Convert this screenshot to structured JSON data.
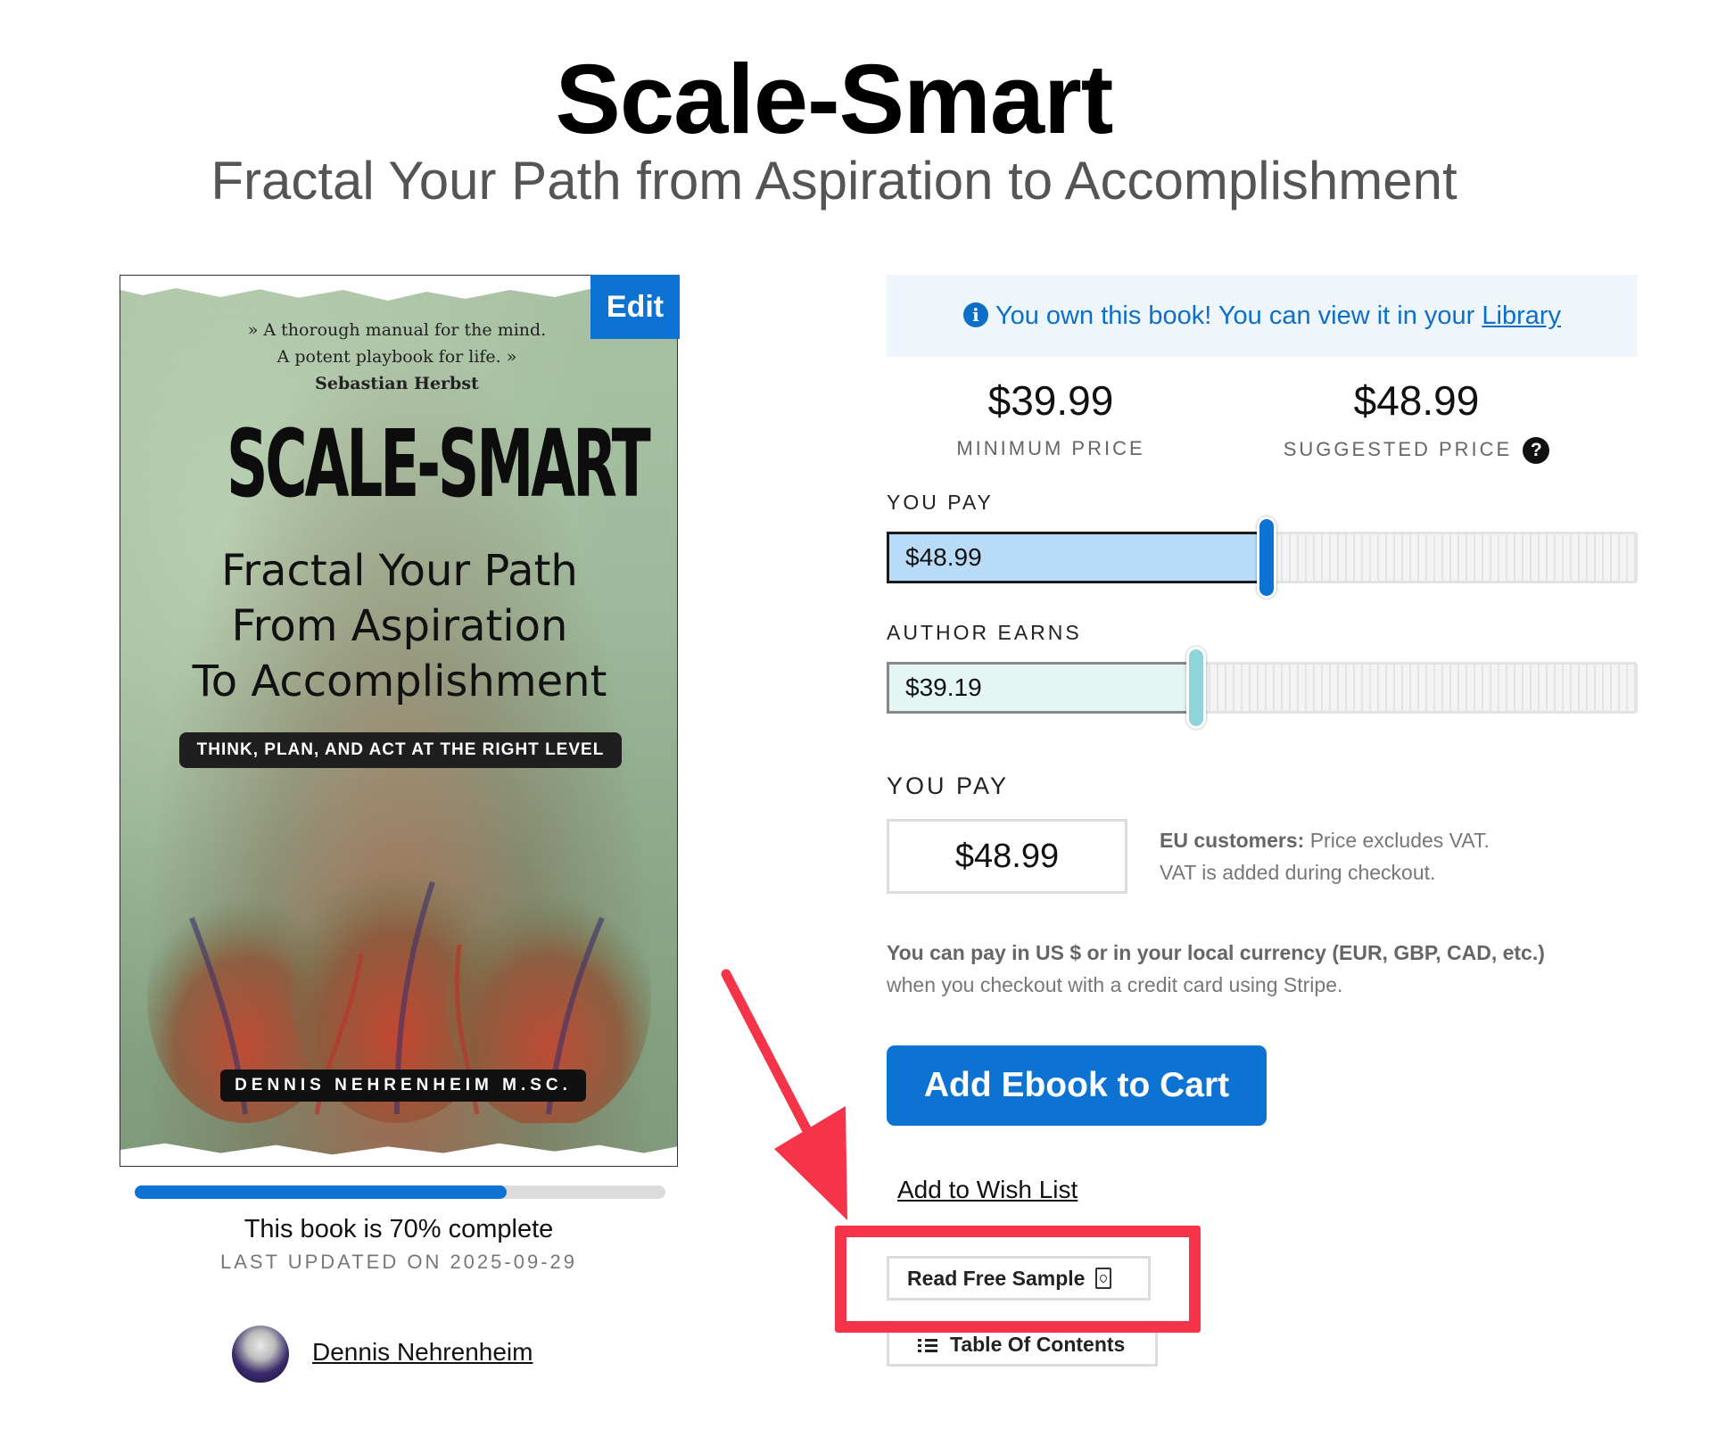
{
  "header": {
    "title": "Scale-Smart",
    "subtitle": "Fractal Your Path from Aspiration to Accomplishment"
  },
  "cover": {
    "quote_line1": "» A thorough manual for the mind.",
    "quote_line2": "A potent playbook for life. »",
    "quote_author": "Sebastian Herbst",
    "title": "SCALE-SMART",
    "subtitle_line1": "Fractal Your Path",
    "subtitle_line2": "From Aspiration",
    "subtitle_line3": "To Accomplishment",
    "tagline": "THINK, PLAN, AND ACT AT THE RIGHT LEVEL",
    "author": "DENNIS NEHRENHEIM M.SC.",
    "edit_label": "Edit"
  },
  "progress": {
    "percent_complete": 70,
    "complete_text": "This book is 70% complete",
    "last_updated": "LAST UPDATED ON 2025-09-29"
  },
  "author": {
    "name": "Dennis Nehrenheim"
  },
  "ownership": {
    "message": "You own this book! You can view it in your ",
    "link_label": "Library"
  },
  "prices": {
    "minimum_amount": "$39.99",
    "minimum_label": "MINIMUM PRICE",
    "suggested_amount": "$48.99",
    "suggested_label": "SUGGESTED PRICE",
    "help_glyph": "?"
  },
  "sliders": {
    "you_pay_label": "YOU PAY",
    "you_pay_value": "$48.99",
    "you_pay_fraction": 0.51,
    "author_earns_label": "AUTHOR EARNS",
    "author_earns_value": "$39.19",
    "author_earns_fraction": 0.415,
    "pay_color": "#b8dcf8",
    "pay_handle_color": "#0d73d3",
    "earn_color": "#e3f6f4",
    "earn_handle_color": "#8fd4d8"
  },
  "payment": {
    "label": "YOU PAY",
    "amount": "$48.99",
    "vat_bold": "EU customers:",
    "vat_line1": " Price excludes VAT.",
    "vat_line2": "VAT is added during checkout.",
    "currency_bold": "You can pay in US $ or in your local currency (EUR, GBP, CAD, etc.)",
    "currency_line2": "when you checkout with a credit card using Stripe."
  },
  "actions": {
    "add_to_cart": "Add Ebook to Cart",
    "wish_list": "Add to Wish List",
    "read_sample": "Read Free Sample",
    "table_of_contents": "Table Of Contents"
  },
  "colors": {
    "accent": "#0d73d3",
    "annotation": "#f5344a"
  }
}
